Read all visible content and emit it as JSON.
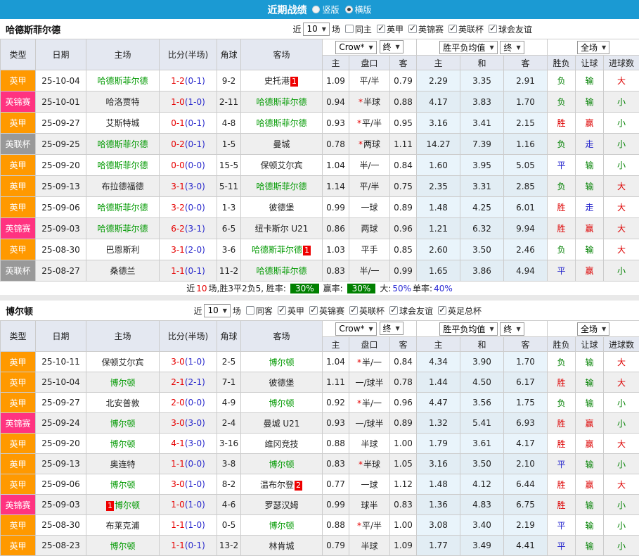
{
  "topbar": {
    "title": "近期战绩",
    "options": [
      {
        "label": "竖版",
        "selected": false
      },
      {
        "label": "横版",
        "selected": true
      }
    ]
  },
  "header": {
    "col_type": "类型",
    "col_date": "日期",
    "col_home": "主场",
    "col_score": "比分(半场)",
    "col_corner": "角球",
    "col_away": "客场",
    "col_home_odds": "主",
    "col_line": "盘口",
    "col_away_odds": "客",
    "col_mean_home": "主",
    "col_mean_draw": "和",
    "col_mean_away": "客",
    "col_wdl": "胜负",
    "col_handicap": "让球",
    "col_goals": "进球数",
    "company_select": "Crow*",
    "final_select": "终",
    "mean_select": "胜平负均值",
    "scope_select": "全场"
  },
  "filter_labels": {
    "near": "近",
    "games": "场"
  },
  "league_colors": {
    "英甲": "#ff9900",
    "英锦赛": "#ff3380",
    "英联杯": "#999999"
  },
  "result_colors": {
    "胜": "#dd0000",
    "平": "#2222cc",
    "负": "#008000",
    "赢": "#dd0000",
    "走": "#2222cc",
    "输": "#008000",
    "大": "#dd0000",
    "小": "#008000"
  },
  "sections": [
    {
      "team": "哈德斯菲尔德",
      "near_count": "10",
      "same_label": "同主",
      "same_checked": false,
      "leagues": [
        "英甲",
        "英锦赛",
        "英联杯",
        "球会友谊"
      ],
      "rows": [
        {
          "league": "英甲",
          "date": "25-10-04",
          "home": "哈德斯菲尔德",
          "home_green": true,
          "home_badge": "",
          "home_badge_left": false,
          "score": "1-2",
          "half": "(0-1)",
          "corner": "9-2",
          "away": "史托港",
          "away_green": false,
          "away_badge": "1",
          "away_badge_left": false,
          "o1": "1.09",
          "line": "平/半",
          "star": false,
          "o2": "0.79",
          "m1": "2.29",
          "m2": "3.35",
          "m3": "2.91",
          "r1": "负",
          "r2": "输",
          "r3": "大"
        },
        {
          "league": "英锦赛",
          "date": "25-10-01",
          "home": "哈洛贾特",
          "home_green": false,
          "home_badge": "",
          "home_badge_left": false,
          "score": "1-0",
          "half": "(1-0)",
          "corner": "2-11",
          "away": "哈德斯菲尔德",
          "away_green": true,
          "away_badge": "",
          "away_badge_left": false,
          "o1": "0.94",
          "line": "半球",
          "star": true,
          "o2": "0.88",
          "m1": "4.17",
          "m2": "3.83",
          "m3": "1.70",
          "r1": "负",
          "r2": "输",
          "r3": "小"
        },
        {
          "league": "英甲",
          "date": "25-09-27",
          "home": "艾斯特城",
          "home_green": false,
          "home_badge": "",
          "home_badge_left": false,
          "score": "0-1",
          "half": "(0-1)",
          "corner": "4-8",
          "away": "哈德斯菲尔德",
          "away_green": true,
          "away_badge": "",
          "away_badge_left": false,
          "o1": "0.93",
          "line": "平/半",
          "star": true,
          "o2": "0.95",
          "m1": "3.16",
          "m2": "3.41",
          "m3": "2.15",
          "r1": "胜",
          "r2": "赢",
          "r3": "小"
        },
        {
          "league": "英联杯",
          "date": "25-09-25",
          "home": "哈德斯菲尔德",
          "home_green": true,
          "home_badge": "",
          "home_badge_left": false,
          "score": "0-2",
          "half": "(0-1)",
          "corner": "1-5",
          "away": "曼城",
          "away_green": false,
          "away_badge": "",
          "away_badge_left": false,
          "o1": "0.78",
          "line": "两球",
          "star": true,
          "o2": "1.11",
          "m1": "14.27",
          "m2": "7.39",
          "m3": "1.16",
          "r1": "负",
          "r2": "走",
          "r3": "小"
        },
        {
          "league": "英甲",
          "date": "25-09-20",
          "home": "哈德斯菲尔德",
          "home_green": true,
          "home_badge": "",
          "home_badge_left": false,
          "score": "0-0",
          "half": "(0-0)",
          "corner": "15-5",
          "away": "保顿艾尔宾",
          "away_green": false,
          "away_badge": "",
          "away_badge_left": false,
          "o1": "1.04",
          "line": "半/一",
          "star": false,
          "o2": "0.84",
          "m1": "1.60",
          "m2": "3.95",
          "m3": "5.05",
          "r1": "平",
          "r2": "输",
          "r3": "小"
        },
        {
          "league": "英甲",
          "date": "25-09-13",
          "home": "布拉德福德",
          "home_green": false,
          "home_badge": "",
          "home_badge_left": false,
          "score": "3-1",
          "half": "(3-0)",
          "corner": "5-11",
          "away": "哈德斯菲尔德",
          "away_green": true,
          "away_badge": "",
          "away_badge_left": false,
          "o1": "1.14",
          "line": "平/半",
          "star": false,
          "o2": "0.75",
          "m1": "2.35",
          "m2": "3.31",
          "m3": "2.85",
          "r1": "负",
          "r2": "输",
          "r3": "大"
        },
        {
          "league": "英甲",
          "date": "25-09-06",
          "home": "哈德斯菲尔德",
          "home_green": true,
          "home_badge": "",
          "home_badge_left": false,
          "score": "3-2",
          "half": "(0-0)",
          "corner": "1-3",
          "away": "彼德堡",
          "away_green": false,
          "away_badge": "",
          "away_badge_left": false,
          "o1": "0.99",
          "line": "一球",
          "star": false,
          "o2": "0.89",
          "m1": "1.48",
          "m2": "4.25",
          "m3": "6.01",
          "r1": "胜",
          "r2": "走",
          "r3": "大"
        },
        {
          "league": "英锦赛",
          "date": "25-09-03",
          "home": "哈德斯菲尔德",
          "home_green": true,
          "home_badge": "",
          "home_badge_left": false,
          "score": "6-2",
          "half": "(3-1)",
          "corner": "6-5",
          "away": "纽卡斯尔 U21",
          "away_green": false,
          "away_badge": "",
          "away_badge_left": false,
          "o1": "0.86",
          "line": "两球",
          "star": false,
          "o2": "0.96",
          "m1": "1.21",
          "m2": "6.32",
          "m3": "9.94",
          "r1": "胜",
          "r2": "赢",
          "r3": "大"
        },
        {
          "league": "英甲",
          "date": "25-08-30",
          "home": "巴恩斯利",
          "home_green": false,
          "home_badge": "",
          "home_badge_left": false,
          "score": "3-1",
          "half": "(2-0)",
          "corner": "3-6",
          "away": "哈德斯菲尔德",
          "away_green": true,
          "away_badge": "1",
          "away_badge_left": false,
          "o1": "1.03",
          "line": "平手",
          "star": false,
          "o2": "0.85",
          "m1": "2.60",
          "m2": "3.50",
          "m3": "2.46",
          "r1": "负",
          "r2": "输",
          "r3": "大"
        },
        {
          "league": "英联杯",
          "date": "25-08-27",
          "home": "桑德兰",
          "home_green": false,
          "home_badge": "",
          "home_badge_left": false,
          "score": "1-1",
          "half": "(0-1)",
          "corner": "11-2",
          "away": "哈德斯菲尔德",
          "away_green": true,
          "away_badge": "",
          "away_badge_left": false,
          "o1": "0.83",
          "line": "半/一",
          "star": false,
          "o2": "0.99",
          "m1": "1.65",
          "m2": "3.86",
          "m3": "4.94",
          "r1": "平",
          "r2": "赢",
          "r3": "小"
        }
      ],
      "summary": {
        "seg1": "近",
        "seg2": "10",
        "seg3": "场,胜3平2负5, 胜率:",
        "badge1": "30%",
        "seg4": "赢率:",
        "badge2": "30%",
        "seg5": "大:",
        "seg6": "50%",
        "seg7": "单率:",
        "seg8": "40%"
      }
    },
    {
      "team": "博尔顿",
      "near_count": "10",
      "same_label": "同客",
      "same_checked": false,
      "leagues": [
        "英甲",
        "英锦赛",
        "英联杯",
        "球会友谊",
        "英足总杯"
      ],
      "rows": [
        {
          "league": "英甲",
          "date": "25-10-11",
          "home": "保顿艾尔宾",
          "home_green": false,
          "home_badge": "",
          "home_badge_left": false,
          "score": "3-0",
          "half": "(1-0)",
          "corner": "2-5",
          "away": "博尔顿",
          "away_green": true,
          "away_badge": "",
          "away_badge_left": false,
          "o1": "1.04",
          "line": "半/一",
          "star": true,
          "o2": "0.84",
          "m1": "4.34",
          "m2": "3.90",
          "m3": "1.70",
          "r1": "负",
          "r2": "输",
          "r3": "大"
        },
        {
          "league": "英甲",
          "date": "25-10-04",
          "home": "博尔顿",
          "home_green": true,
          "home_badge": "",
          "home_badge_left": false,
          "score": "2-1",
          "half": "(2-1)",
          "corner": "7-1",
          "away": "彼德堡",
          "away_green": false,
          "away_badge": "",
          "away_badge_left": false,
          "o1": "1.11",
          "line": "一/球半",
          "star": false,
          "o2": "0.78",
          "m1": "1.44",
          "m2": "4.50",
          "m3": "6.17",
          "r1": "胜",
          "r2": "输",
          "r3": "大"
        },
        {
          "league": "英甲",
          "date": "25-09-27",
          "home": "北安普敦",
          "home_green": false,
          "home_badge": "",
          "home_badge_left": false,
          "score": "2-0",
          "half": "(0-0)",
          "corner": "4-9",
          "away": "博尔顿",
          "away_green": true,
          "away_badge": "",
          "away_badge_left": false,
          "o1": "0.92",
          "line": "半/一",
          "star": true,
          "o2": "0.96",
          "m1": "4.47",
          "m2": "3.56",
          "m3": "1.75",
          "r1": "负",
          "r2": "输",
          "r3": "小"
        },
        {
          "league": "英锦赛",
          "date": "25-09-24",
          "home": "博尔顿",
          "home_green": true,
          "home_badge": "",
          "home_badge_left": false,
          "score": "3-0",
          "half": "(3-0)",
          "corner": "2-4",
          "away": "曼城 U21",
          "away_green": false,
          "away_badge": "",
          "away_badge_left": false,
          "o1": "0.93",
          "line": "一/球半",
          "star": false,
          "o2": "0.89",
          "m1": "1.32",
          "m2": "5.41",
          "m3": "6.93",
          "r1": "胜",
          "r2": "赢",
          "r3": "小"
        },
        {
          "league": "英甲",
          "date": "25-09-20",
          "home": "博尔顿",
          "home_green": true,
          "home_badge": "",
          "home_badge_left": false,
          "score": "4-1",
          "half": "(3-0)",
          "corner": "3-16",
          "away": "维冈竞技",
          "away_green": false,
          "away_badge": "",
          "away_badge_left": false,
          "o1": "0.88",
          "line": "半球",
          "star": false,
          "o2": "1.00",
          "m1": "1.79",
          "m2": "3.61",
          "m3": "4.17",
          "r1": "胜",
          "r2": "赢",
          "r3": "大"
        },
        {
          "league": "英甲",
          "date": "25-09-13",
          "home": "奥连特",
          "home_green": false,
          "home_badge": "",
          "home_badge_left": false,
          "score": "1-1",
          "half": "(0-0)",
          "corner": "3-8",
          "away": "博尔顿",
          "away_green": true,
          "away_badge": "",
          "away_badge_left": false,
          "o1": "0.83",
          "line": "半球",
          "star": true,
          "o2": "1.05",
          "m1": "3.16",
          "m2": "3.50",
          "m3": "2.10",
          "r1": "平",
          "r2": "输",
          "r3": "小"
        },
        {
          "league": "英甲",
          "date": "25-09-06",
          "home": "博尔顿",
          "home_green": true,
          "home_badge": "",
          "home_badge_left": false,
          "score": "3-0",
          "half": "(1-0)",
          "corner": "8-2",
          "away": "温布尔登",
          "away_green": false,
          "away_badge": "2",
          "away_badge_left": false,
          "o1": "0.77",
          "line": "一球",
          "star": false,
          "o2": "1.12",
          "m1": "1.48",
          "m2": "4.12",
          "m3": "6.44",
          "r1": "胜",
          "r2": "赢",
          "r3": "大"
        },
        {
          "league": "英锦赛",
          "date": "25-09-03",
          "home": "博尔顿",
          "home_green": true,
          "home_badge": "1",
          "home_badge_left": true,
          "score": "1-0",
          "half": "(1-0)",
          "corner": "4-6",
          "away": "罗瑟汉姆",
          "away_green": false,
          "away_badge": "",
          "away_badge_left": false,
          "o1": "0.99",
          "line": "球半",
          "star": false,
          "o2": "0.83",
          "m1": "1.36",
          "m2": "4.83",
          "m3": "6.75",
          "r1": "胜",
          "r2": "输",
          "r3": "小"
        },
        {
          "league": "英甲",
          "date": "25-08-30",
          "home": "布莱克浦",
          "home_green": false,
          "home_badge": "",
          "home_badge_left": false,
          "score": "1-1",
          "half": "(1-0)",
          "corner": "0-5",
          "away": "博尔顿",
          "away_green": true,
          "away_badge": "",
          "away_badge_left": false,
          "o1": "0.88",
          "line": "平/半",
          "star": true,
          "o2": "1.00",
          "m1": "3.08",
          "m2": "3.40",
          "m3": "2.19",
          "r1": "平",
          "r2": "输",
          "r3": "小"
        },
        {
          "league": "英甲",
          "date": "25-08-23",
          "home": "博尔顿",
          "home_green": true,
          "home_badge": "",
          "home_badge_left": false,
          "score": "1-1",
          "half": "(0-1)",
          "corner": "13-2",
          "away": "林肯城",
          "away_green": false,
          "away_badge": "",
          "away_badge_left": false,
          "o1": "0.79",
          "line": "半球",
          "star": false,
          "o2": "1.09",
          "m1": "1.77",
          "m2": "3.49",
          "m3": "4.41",
          "r1": "平",
          "r2": "输",
          "r3": "小"
        }
      ]
    }
  ]
}
